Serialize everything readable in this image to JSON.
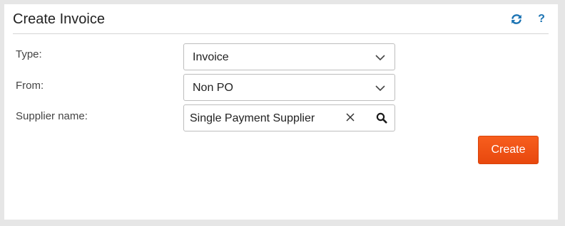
{
  "header": {
    "title": "Create Invoice",
    "help_label": "?",
    "refresh_icon": "refresh-icon",
    "help_icon": "help-icon"
  },
  "form": {
    "type": {
      "label": "Type:",
      "value": "Invoice"
    },
    "from": {
      "label": "From:",
      "value": "Non PO"
    },
    "supplier": {
      "label": "Supplier name:",
      "value": "Single Payment Supplier"
    }
  },
  "actions": {
    "create_label": "Create"
  },
  "colors": {
    "accent": "#1b73b3",
    "primary_button": "#f05418"
  }
}
